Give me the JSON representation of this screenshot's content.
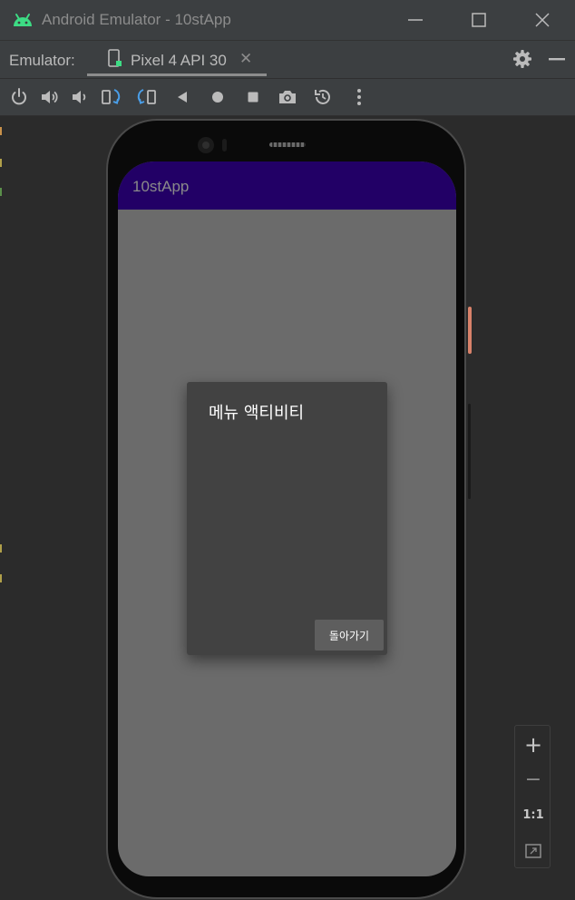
{
  "window": {
    "title": "Android Emulator - 10stApp",
    "minimize_icon": "minimize-icon",
    "maximize_icon": "maximize-icon",
    "close_icon": "close-icon"
  },
  "tabbar": {
    "label": "Emulator:",
    "tab_label": "Pixel 4 API 30",
    "tab_close": "✕",
    "right_icons": [
      "gear-icon",
      "minimize-panel-icon"
    ]
  },
  "toolbar": {
    "icons": [
      "power-icon",
      "volume-up-icon",
      "volume-down-icon",
      "rotate-left-icon",
      "rotate-right-icon",
      "back-icon",
      "home-icon",
      "overview-icon",
      "screenshot-icon",
      "snapshot-icon",
      "more-icon"
    ]
  },
  "app": {
    "title": "10stApp",
    "appbar_color": "#220066"
  },
  "dialog": {
    "title": "메뉴 액티비티",
    "button_label": "돌아가기"
  },
  "zoom": {
    "plus": "+",
    "minus": "−",
    "one_to_one": "1:1",
    "fit_icon": "fit-screen-icon"
  }
}
